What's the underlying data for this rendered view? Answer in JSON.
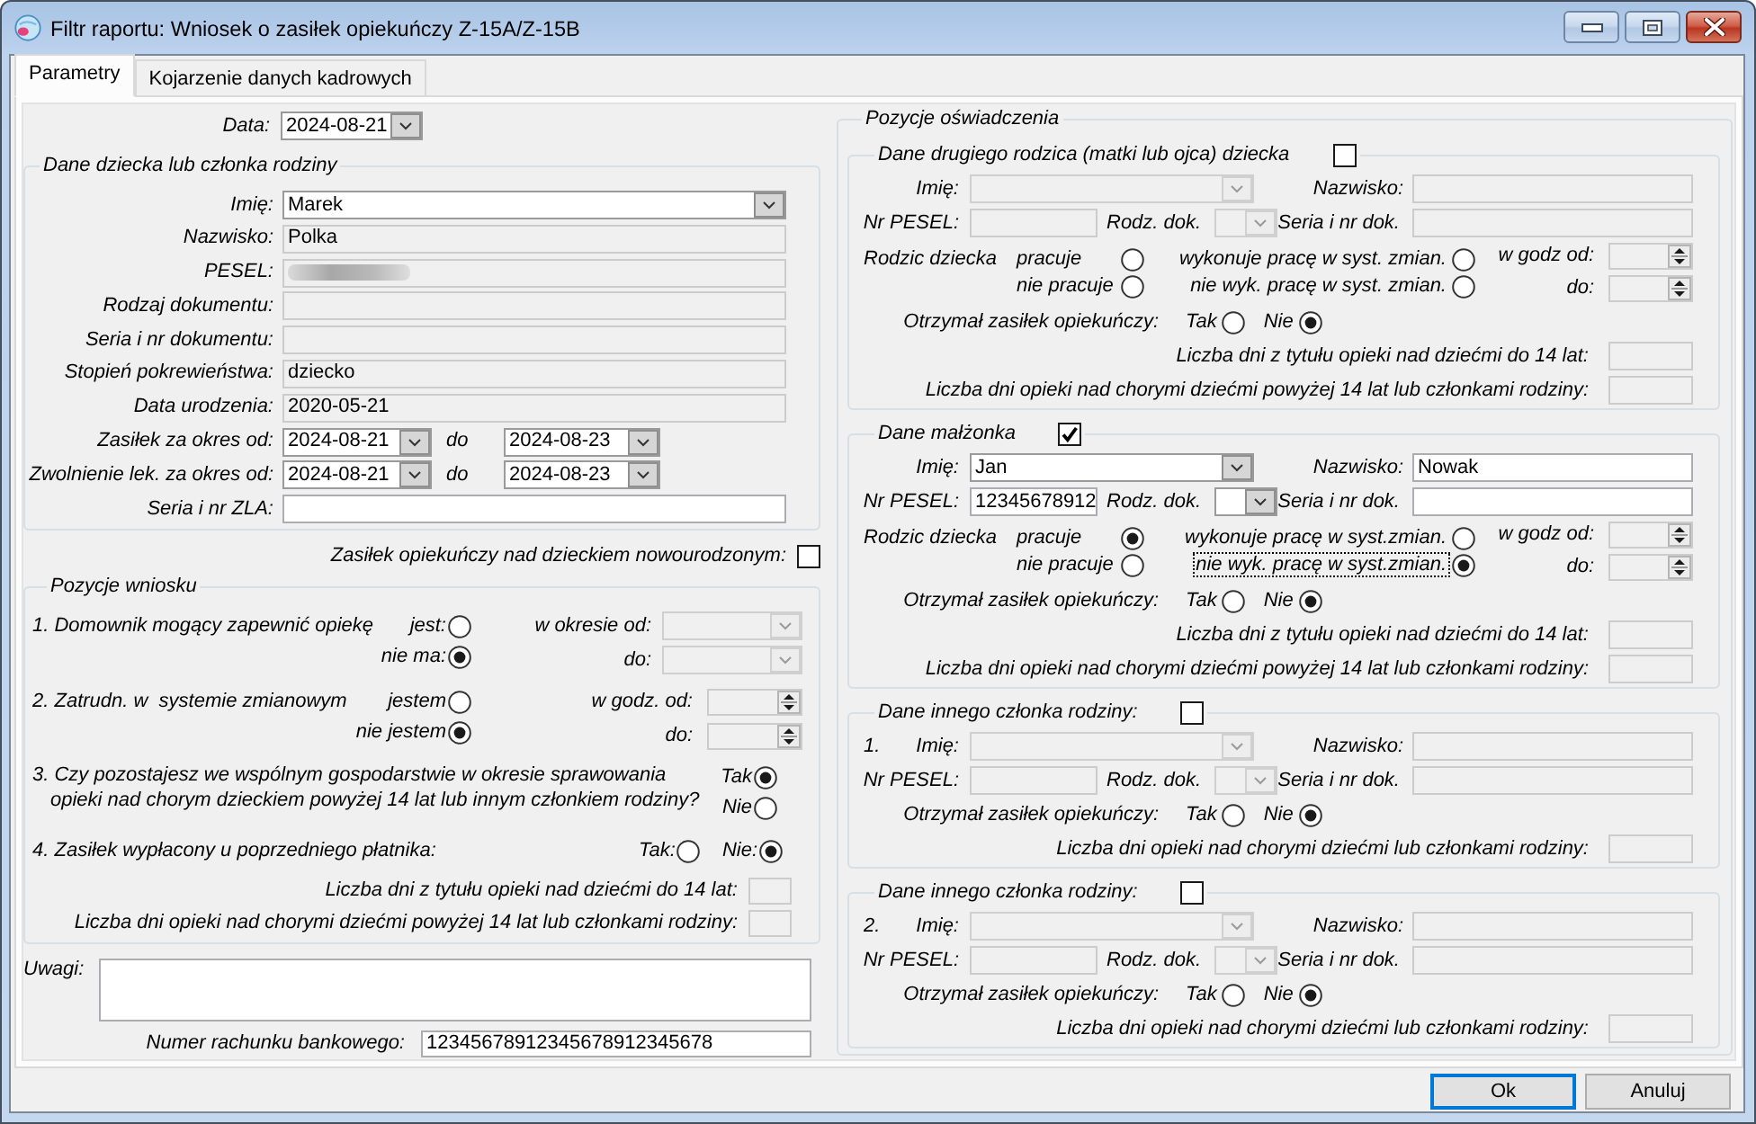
{
  "window": {
    "title": "Filtr raportu: Wniosek o zasiłek opiekuńczy Z-15A/Z-15B"
  },
  "tabs": [
    {
      "label": "Parametry",
      "selected": true
    },
    {
      "label": "Kojarzenie danych kadrowych",
      "selected": false
    }
  ],
  "date": {
    "label": "Data:",
    "value": "2024-08-21",
    "disabled": false
  },
  "child_data": {
    "title": "Dane dziecka lub członka rodziny",
    "fields": [
      {
        "kind": "dropdown",
        "label": "Imię:",
        "value": "Marek",
        "disabled": false
      },
      {
        "kind": "text",
        "label": "Nazwisko:",
        "value": "Polka",
        "disabled": true
      },
      {
        "kind": "text",
        "label": "PESEL:",
        "redacted": true,
        "disabled": true
      },
      {
        "kind": "text",
        "label": "Rodzaj dokumentu:",
        "disabled": true
      },
      {
        "kind": "text",
        "label": "Seria i nr dokumentu:",
        "disabled": true
      },
      {
        "kind": "text",
        "label": "Stopień pokrewieństwa:",
        "value": "dziecko",
        "disabled": true
      },
      {
        "kind": "text",
        "label": "Data urodzenia:",
        "value": "2020-05-21",
        "disabled": true
      },
      {
        "kind": "date_range",
        "label": "Zasiłek za okres od:",
        "from": "2024-08-21",
        "to_label": "do",
        "to": "2024-08-23",
        "disabled": false
      },
      {
        "kind": "date_range",
        "label": "Zwolnienie lek. za okres od:",
        "from": "2024-08-21",
        "to_label": "do",
        "to": "2024-08-23",
        "disabled": false
      },
      {
        "kind": "text",
        "label": "Seria i nr ZLA:",
        "disabled": false
      }
    ]
  },
  "newborn": {
    "label": "Zasiłek opiekuńczy nad dzieckiem nowourodzonym:",
    "checked": false
  },
  "application_items": {
    "title": "Pozycje wniosku",
    "items": [
      {
        "kind": "range",
        "question": "1. Domownik mogący zapewnić opiekę",
        "options": [
          {
            "label": "jest:",
            "selected": false
          },
          {
            "label": "nie ma:",
            "selected": true
          }
        ],
        "range": {
          "kind": "dropdown",
          "from_label": "w okresie od:",
          "to_label": "do:",
          "disabled": true
        }
      },
      {
        "kind": "range",
        "question": "2. Zatrudn. w  systemie zmianowym",
        "options": [
          {
            "label": "jestem",
            "selected": false
          },
          {
            "label": "nie jestem",
            "selected": true
          }
        ],
        "range": {
          "kind": "spin",
          "from_label": "w godz. od:",
          "to_label": "do:",
          "disabled": true
        }
      },
      {
        "kind": "stacked",
        "question": "3. Czy pozostajesz we wspólnym gospodarstwie w okresie sprawowania\nopieki nad chorym dzieckiem powyżej 14 lat lub innym członkiem rodziny?",
        "options": [
          {
            "label": "Tak",
            "selected": true
          },
          {
            "label": "Nie",
            "selected": false
          }
        ]
      },
      {
        "kind": "inline",
        "question": "4. Zasiłek wypłacony u poprzedniego płatnika:",
        "options": [
          {
            "label": "Tak:",
            "selected": false
          },
          {
            "label": "Nie:",
            "selected": true
          }
        ]
      }
    ],
    "day_counts": [
      {
        "label": "Liczba dni z tytułu opieki nad dziećmi do 14 lat:",
        "disabled": true
      },
      {
        "label": "Liczba dni opieki nad chorymi dziećmi powyżej 14 lat lub członkami rodziny:",
        "disabled": true
      }
    ]
  },
  "remarks": {
    "label": "Uwagi:"
  },
  "bank_account": {
    "label": "Numer rachunku bankowego:",
    "value": "12345678912345678912345678"
  },
  "declaration": {
    "title": "Pozycje oświadczenia",
    "sections": [
      {
        "title": "Dane drugiego rodzica (matki lub ojca) dziecka",
        "checked": false,
        "name": {
          "label": "Imię:",
          "disabled": true
        },
        "surname": {
          "label": "Nazwisko:",
          "disabled": true
        },
        "pesel": {
          "label": "Nr PESEL:",
          "disabled": true
        },
        "doc_type": {
          "label": "Rodz. dok.",
          "disabled": true
        },
        "doc_number": {
          "label": "Seria i nr dok.",
          "disabled": true
        },
        "parent": {
          "label": "Rodzic dziecka",
          "work": [
            {
              "label": "pracuje",
              "selected": false
            },
            {
              "label": "nie pracuje",
              "selected": false
            }
          ],
          "shift": [
            {
              "label": "wykonuje pracę w syst. zmian.",
              "selected": false,
              "focused": false
            },
            {
              "label": "nie wyk. pracę w syst. zmian.",
              "selected": false,
              "focused": false
            }
          ],
          "hours": {
            "from_label": "w godz od:",
            "to_label": "do:",
            "disabled": true
          }
        },
        "benefit": {
          "label": "Otrzymał zasiłek opiekuńczy:",
          "options": [
            {
              "label": "Tak",
              "selected": false
            },
            {
              "label": "Nie",
              "selected": true
            }
          ]
        },
        "day_counts": [
          {
            "label": "Liczba dni z tytułu opieki nad dziećmi do 14 lat:",
            "disabled": true
          },
          {
            "label": "Liczba dni opieki nad chorymi dziećmi powyżej 14 lat lub członkami rodziny:",
            "disabled": true
          }
        ]
      },
      {
        "title": "Dane małżonka",
        "checked": true,
        "name": {
          "label": "Imię:",
          "value": "Jan",
          "disabled": false
        },
        "surname": {
          "label": "Nazwisko:",
          "value": "Nowak",
          "disabled": false
        },
        "pesel": {
          "label": "Nr PESEL:",
          "value": "12345678912",
          "disabled": false
        },
        "doc_type": {
          "label": "Rodz. dok.",
          "disabled": false
        },
        "doc_number": {
          "label": "Seria i nr dok.",
          "disabled": false
        },
        "parent": {
          "label": "Rodzic dziecka",
          "work": [
            {
              "label": "pracuje",
              "selected": true
            },
            {
              "label": "nie pracuje",
              "selected": false
            }
          ],
          "shift": [
            {
              "label": "wykonuje pracę w syst.zmian.",
              "selected": false,
              "focused": false
            },
            {
              "label": "nie wyk. pracę w syst.zmian.",
              "selected": true,
              "focused": true
            }
          ],
          "hours": {
            "from_label": "w godz od:",
            "to_label": "do:",
            "disabled": true
          }
        },
        "benefit": {
          "label": "Otrzymał zasiłek opiekuńczy:",
          "options": [
            {
              "label": "Tak",
              "selected": false
            },
            {
              "label": "Nie",
              "selected": true
            }
          ]
        },
        "day_counts": [
          {
            "label": "Liczba dni z tytułu opieki nad dziećmi do 14 lat:",
            "disabled": true
          },
          {
            "label": "Liczba dni opieki nad chorymi dziećmi powyżej 14 lat lub członkami rodziny:",
            "disabled": true
          }
        ]
      },
      {
        "title": "Dane innego członka rodziny:",
        "checked": false,
        "number": "1.",
        "name": {
          "label": "Imię:",
          "disabled": true
        },
        "surname": {
          "label": "Nazwisko:",
          "disabled": true
        },
        "pesel": {
          "label": "Nr PESEL:",
          "disabled": true
        },
        "doc_type": {
          "label": "Rodz. dok.",
          "disabled": true
        },
        "doc_number": {
          "label": "Seria i nr dok.",
          "disabled": true
        },
        "benefit": {
          "label": "Otrzymał zasiłek opiekuńczy:",
          "options": [
            {
              "label": "Tak",
              "selected": false
            },
            {
              "label": "Nie",
              "selected": true
            }
          ]
        },
        "day_counts": [
          {
            "label": "Liczba dni opieki nad chorymi dziećmi lub członkami rodziny:",
            "disabled": true
          }
        ]
      },
      {
        "title": "Dane innego członka rodziny:",
        "checked": false,
        "number": "2.",
        "name": {
          "label": "Imię:",
          "disabled": true
        },
        "surname": {
          "label": "Nazwisko:",
          "disabled": true
        },
        "pesel": {
          "label": "Nr PESEL:",
          "disabled": true
        },
        "doc_type": {
          "label": "Rodz. dok.",
          "disabled": true
        },
        "doc_number": {
          "label": "Seria i nr dok.",
          "disabled": true
        },
        "benefit": {
          "label": "Otrzymał zasiłek opiekuńczy:",
          "options": [
            {
              "label": "Tak",
              "selected": false
            },
            {
              "label": "Nie",
              "selected": true
            }
          ]
        },
        "day_counts": [
          {
            "label": "Liczba dni opieki nad chorymi dziećmi lub członkami rodziny:",
            "disabled": true
          }
        ]
      }
    ]
  },
  "buttons": [
    {
      "label": "Ok",
      "default": true
    },
    {
      "label": "Anuluj",
      "default": false
    }
  ]
}
